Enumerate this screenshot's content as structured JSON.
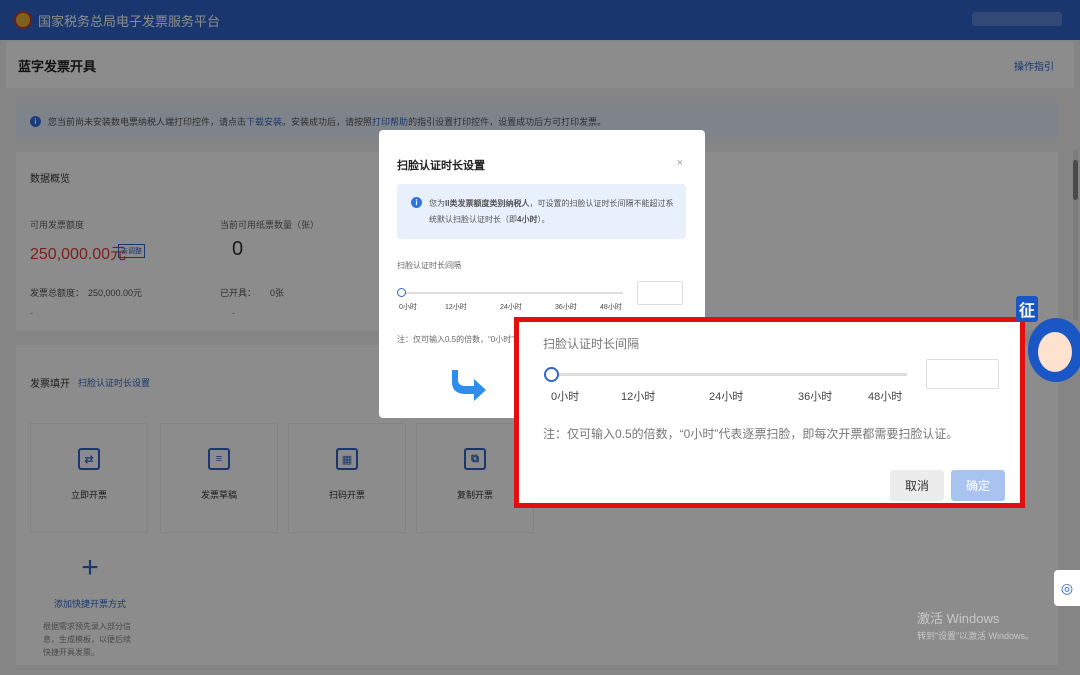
{
  "header": {
    "app_title": "国家税务总局电子发票服务平台"
  },
  "page": {
    "title": "蓝字发票开具",
    "guide_link": "操作指引"
  },
  "notice": {
    "text_before": "您当前尚未安装数电票纳税人端打印控件，请点击",
    "link1": "下载安装",
    "text_middle": "。安装成功后，请按照",
    "link2": "打印帮助",
    "text_after": "的指引设置打印控件，设置成功后方可打印发票。"
  },
  "overview": {
    "title": "数据概览",
    "quota_label": "可用发票额度",
    "quota_value": "250,000.00元",
    "quota_tag": "去调整",
    "paper_label": "当前可用纸票数量（张）",
    "paper_value": "0",
    "total_label": "发票总额度：",
    "total_value": "250,000.00元",
    "issued_label": "已开具：",
    "issued_value": "0张",
    "dash": "-"
  },
  "fill": {
    "title": "发票填开",
    "link": "扫脸认证时长设置",
    "tiles": [
      {
        "label": "立即开票",
        "icon": "invoice-now-icon"
      },
      {
        "label": "发票草稿",
        "icon": "draft-icon"
      },
      {
        "label": "扫码开票",
        "icon": "qr-code-icon"
      },
      {
        "label": "复制开票",
        "icon": "copy-icon"
      }
    ],
    "add_label": "添加快捷开票方式",
    "add_desc": "根据需求预先录入部分信息，生成模板，以便后续快捷开具发票。"
  },
  "modal": {
    "title": "扫脸认证时长设置",
    "close": "×",
    "info_prefix": "您为",
    "info_bold1": "II类发票额度类别纳税人",
    "info_mid": "，可设置的扫脸认证时长间隔不能超过系统默认扫脸认证时长（即",
    "info_bold2": "4小时",
    "info_suffix": "）。",
    "slider_label": "扫脸认证时长间隔",
    "ticks": [
      "0小时",
      "12小时",
      "24小时",
      "36小时",
      "48小时"
    ],
    "input_value": "",
    "note": "注：仅可输入0.5的倍数，“0小时”代表逐票扫脸，即每次开票都需要扫脸认证。"
  },
  "zoom": {
    "slider_label": "扫脸认证时长间隔",
    "ticks": [
      "0小时",
      "12小时",
      "24小时",
      "36小时",
      "48小时"
    ],
    "input_value": "",
    "note": "注：仅可输入0.5的倍数，“0小时”代表逐票扫脸，即每次开票都需要扫脸认证。",
    "cancel": "取消",
    "confirm": "确定"
  },
  "slider": {
    "value": 0,
    "min": 0,
    "max": 48
  },
  "mascot": {
    "badge": "征"
  },
  "side_tool": {
    "icon": "tool-icon",
    "glyph": "◎"
  },
  "watermark": {
    "line1": "激活 Windows",
    "line2": "转到“设置”以激活 Windows。"
  },
  "colors": {
    "primary": "#2f64c8",
    "highlight_border": "#e30f0f",
    "amount": "#e53935"
  }
}
